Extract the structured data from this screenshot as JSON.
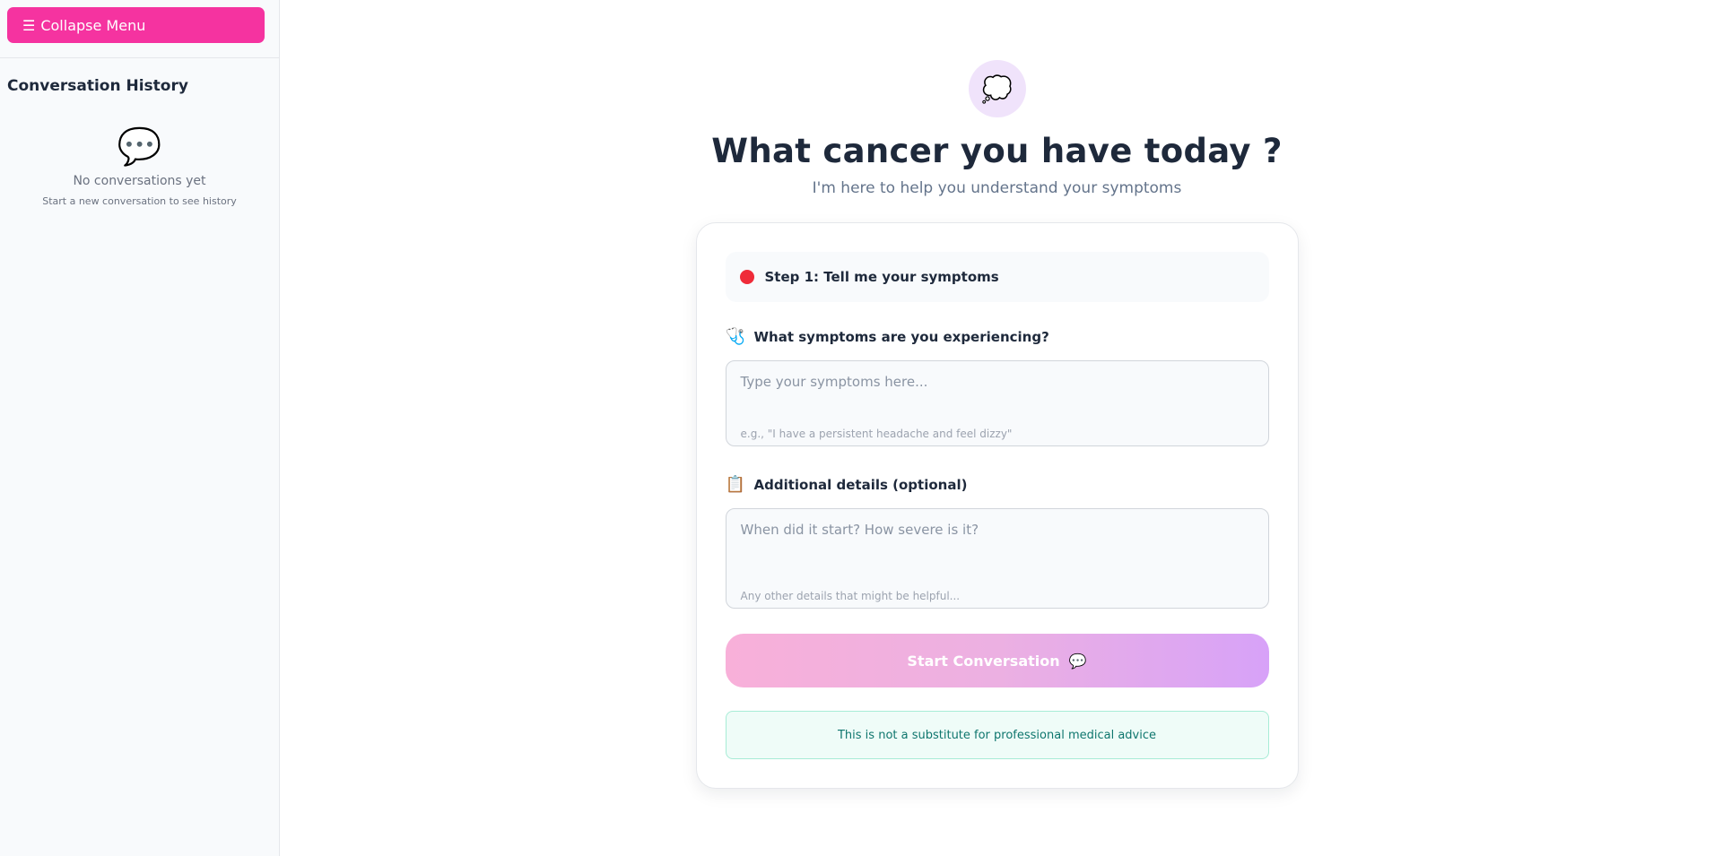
{
  "sidebar": {
    "collapse_icon": "☰",
    "collapse_label": "Collapse Menu",
    "history_title": "Conversation History",
    "empty_icon": "💬",
    "empty_title": "No conversations yet",
    "empty_subtitle": "Start a new conversation to see history"
  },
  "hero": {
    "icon": "💭",
    "title": "What cancer you have today ?",
    "subtitle": "I'm here to help you understand your symptoms"
  },
  "form": {
    "step_label": "Step 1: Tell me your symptoms",
    "symptoms": {
      "icon": "🩺",
      "label": "What symptoms are you experiencing?",
      "placeholder": "Type your symptoms here...",
      "value": "",
      "hint": "e.g., \"I have a persistent headache and feel dizzy\""
    },
    "details": {
      "icon": "📋",
      "label": "Additional details (optional)",
      "placeholder": "When did it start? How severe is it?",
      "value": "",
      "hint": "Any other details that might be helpful..."
    },
    "start_button": {
      "label": "Start Conversation",
      "icon": "💬"
    },
    "disclaimer": "This is not a substitute for professional medical advice"
  },
  "colors": {
    "accent": "#f533a0",
    "step_dot": "#ef2b39",
    "button_gradient_start": "#f8b0d9",
    "button_gradient_end": "#d7a2f8",
    "disclaimer_bg": "#effcf8",
    "disclaimer_text": "#0f766e"
  }
}
